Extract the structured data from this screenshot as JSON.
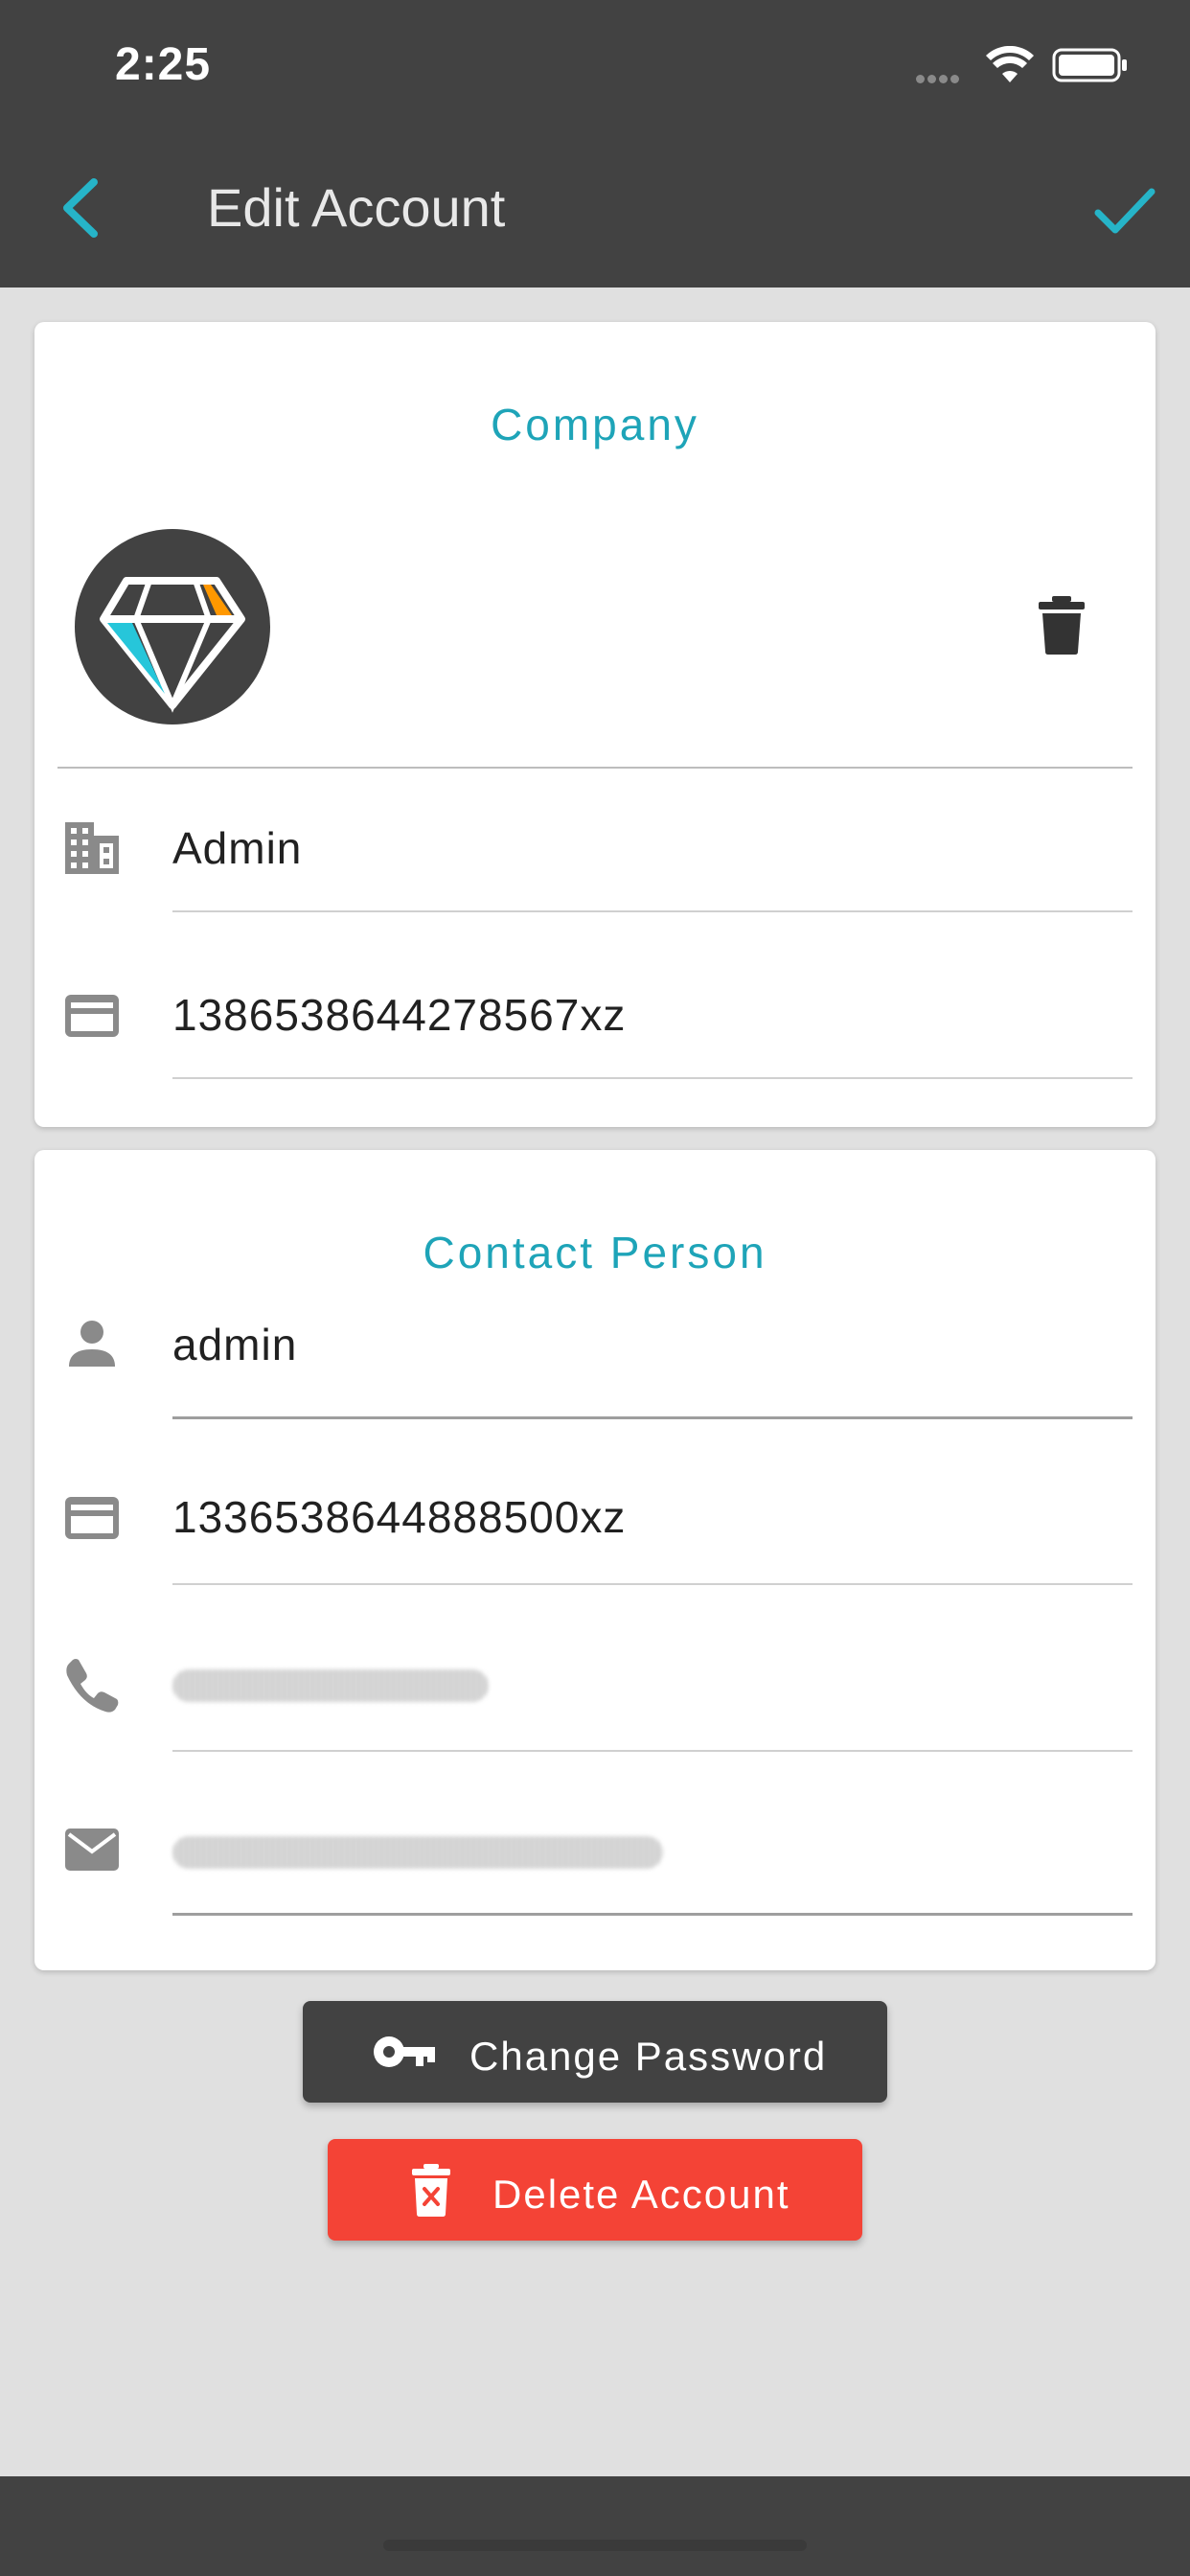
{
  "status_bar": {
    "time": "2:25"
  },
  "app_bar": {
    "title": "Edit Account",
    "back_icon": "chevron-left-icon",
    "save_icon": "check-icon",
    "accent": "#26b4c8"
  },
  "company": {
    "title": "Company",
    "name": "Admin",
    "id_number": "1386538644278567xz"
  },
  "contact": {
    "title": "Contact Person",
    "name": "admin",
    "id_number": "1336538644888500xz"
  },
  "buttons": {
    "change_password": "Change Password",
    "delete_account": "Delete Account"
  },
  "colors": {
    "header": "#424242",
    "accent": "#1ea4b8",
    "danger": "#f44336",
    "logo_cyan": "#26c6da",
    "logo_orange": "#ff9800"
  }
}
